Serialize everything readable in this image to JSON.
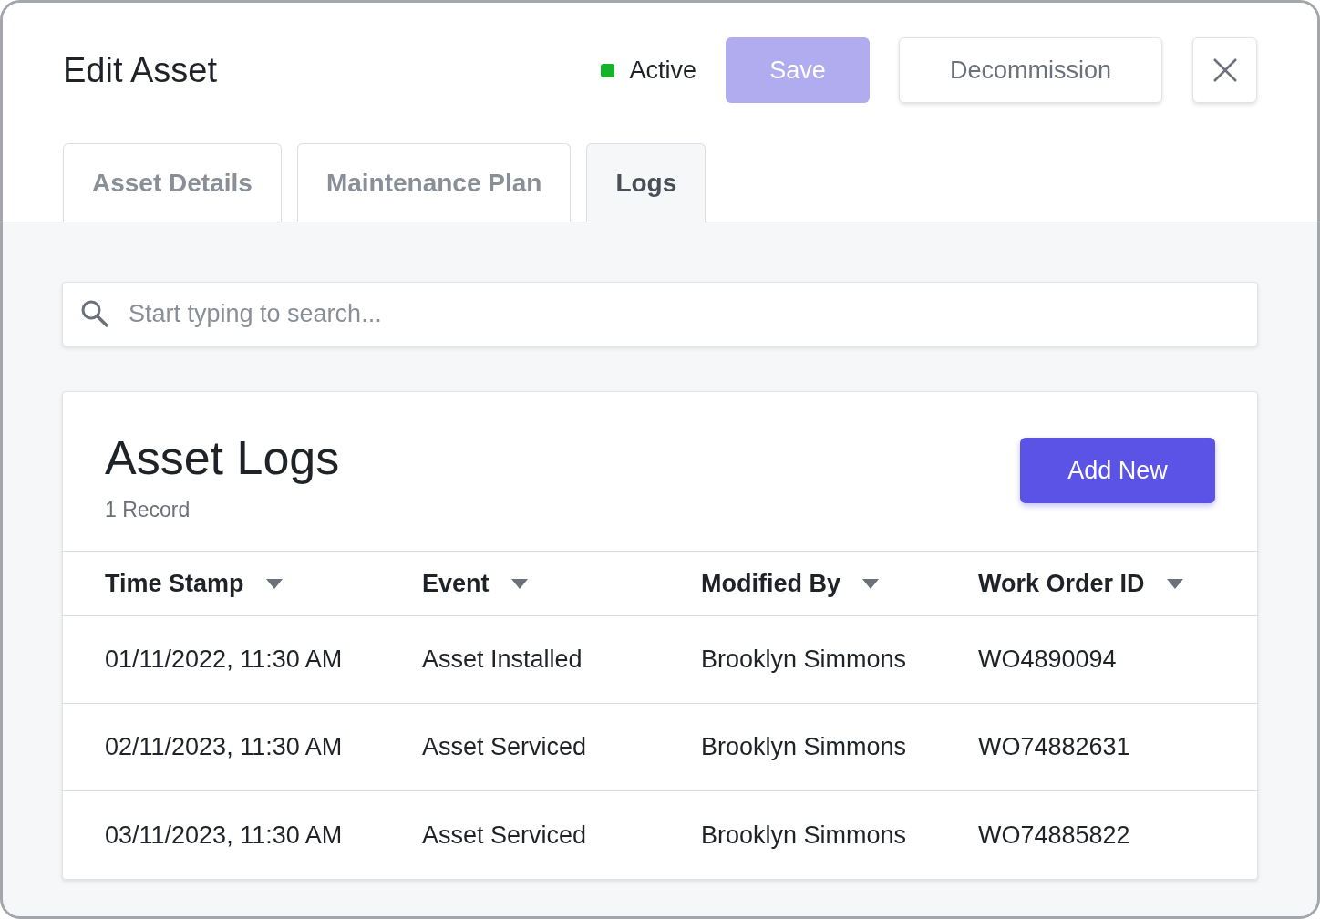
{
  "header": {
    "title": "Edit Asset",
    "status": {
      "label": "Active",
      "color": "#16b22a"
    },
    "save_button": {
      "label": "Save",
      "disabled": true
    },
    "decommission_button": {
      "label": "Decommission"
    }
  },
  "tabs": [
    {
      "label": "Asset Details",
      "selected": false
    },
    {
      "label": "Maintenance Plan",
      "selected": false
    },
    {
      "label": "Logs",
      "selected": true
    }
  ],
  "search": {
    "placeholder": "Start typing to search..."
  },
  "logs": {
    "title": "Asset Logs",
    "count": "1 Record",
    "add_button": "Add New",
    "columns": [
      "Time Stamp",
      "Event",
      "Modified By",
      "Work Order ID"
    ],
    "rows": [
      [
        "01/11/2022, 11:30 AM",
        "Asset Installed",
        "Brooklyn Simmons",
        "WO4890094"
      ],
      [
        "02/11/2023, 11:30 AM",
        "Asset Serviced",
        "Brooklyn Simmons",
        "WO74882631"
      ],
      [
        "03/11/2023, 11:30 AM",
        "Asset Serviced",
        "Brooklyn Simmons",
        "WO74885822"
      ]
    ]
  }
}
